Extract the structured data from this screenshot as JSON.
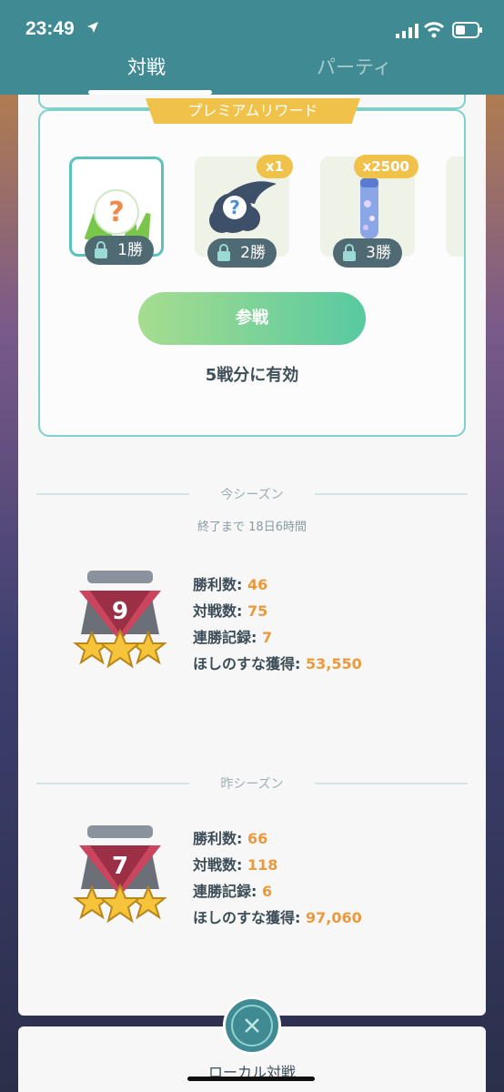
{
  "status_bar": {
    "time": "23:49"
  },
  "tabs": [
    {
      "label": "対戦"
    },
    {
      "label": "パーティ"
    }
  ],
  "rewards": {
    "banner": "プレミアムリワード",
    "items": [
      {
        "icon": "mystery-encounter-grass-icon",
        "lock_label": "1勝",
        "quantity": ""
      },
      {
        "icon": "mystery-stardust-cloud-icon",
        "lock_label": "2勝",
        "quantity": "x1"
      },
      {
        "icon": "stardust-vial-icon",
        "lock_label": "3勝",
        "quantity": "x2500"
      }
    ],
    "join_button": "参戦",
    "valid_text": "5戦分に有効"
  },
  "current_season": {
    "title": "今シーズン",
    "remaining": "終了まで 18日6時間",
    "rank": "9",
    "stats": [
      {
        "label": "勝利数:",
        "value": "46"
      },
      {
        "label": "対戦数:",
        "value": "75"
      },
      {
        "label": "連勝記録:",
        "value": "7"
      },
      {
        "label": "ほしのすな獲得:",
        "value": "53,550"
      }
    ]
  },
  "previous_season": {
    "title": "昨シーズン",
    "rank": "7",
    "stats": [
      {
        "label": "勝利数:",
        "value": "66"
      },
      {
        "label": "対戦数:",
        "value": "118"
      },
      {
        "label": "連勝記録:",
        "value": "6"
      },
      {
        "label": "ほしのすな獲得:",
        "value": "97,060"
      }
    ]
  },
  "bottom": {
    "local_battle_label": "ローカル対戦"
  },
  "colors": {
    "header": "#3f8a93",
    "accent": "#f1c24a",
    "value": "#ea9a3d"
  }
}
